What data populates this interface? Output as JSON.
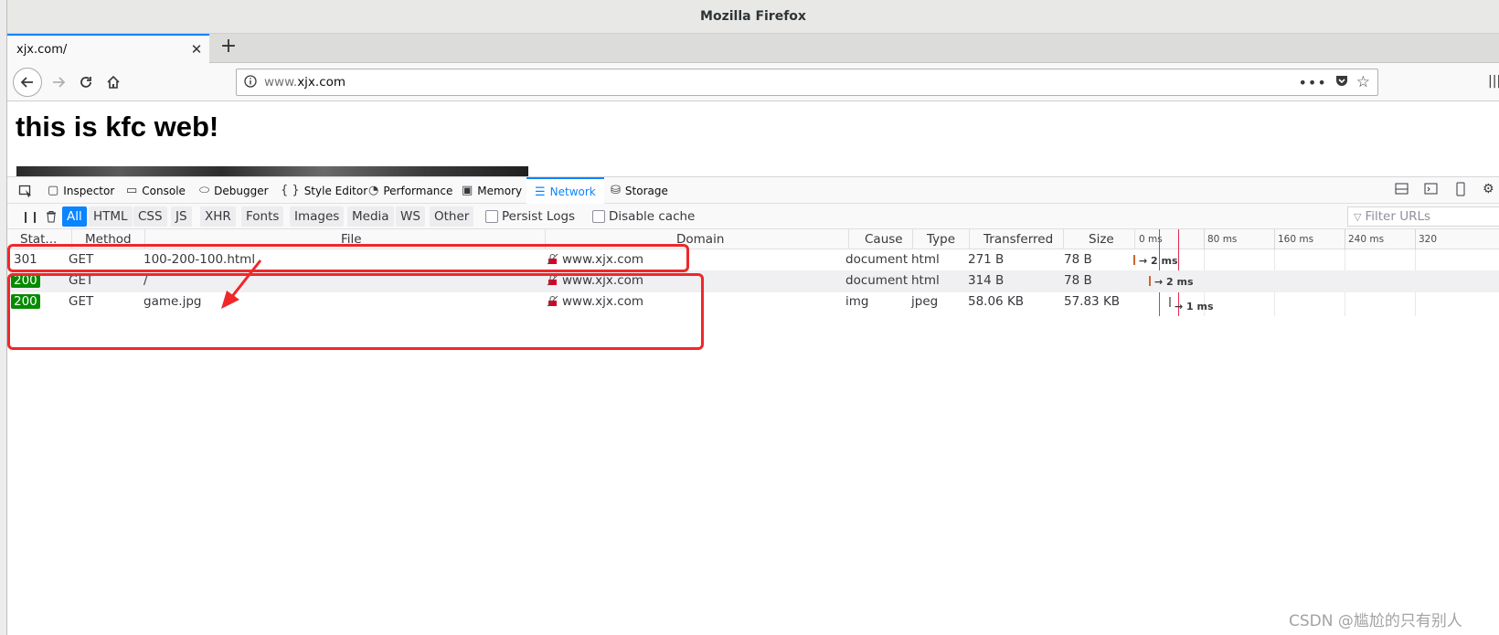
{
  "window": {
    "title": "Mozilla Firefox"
  },
  "tabs": [
    {
      "title": "xjx.com/",
      "close_icon": "close-icon"
    }
  ],
  "newtab_icon": "plus-icon",
  "navbar": {
    "url_prefix": "www.",
    "url_host": "xjx.com",
    "icons": [
      "back-arrow-icon",
      "forward-arrow-icon",
      "reload-icon",
      "home-icon",
      "info-icon",
      "more-icon",
      "pocket-icon",
      "star-icon",
      "library-icon"
    ]
  },
  "page": {
    "heading": "this is kfc web!"
  },
  "devtools": {
    "tabs": [
      {
        "label": "Inspector",
        "icon": "inspector-icon"
      },
      {
        "label": "Console",
        "icon": "console-icon"
      },
      {
        "label": "Debugger",
        "icon": "debugger-icon"
      },
      {
        "label": "Style Editor",
        "icon": "braces-icon"
      },
      {
        "label": "Performance",
        "icon": "performance-icon"
      },
      {
        "label": "Memory",
        "icon": "memory-icon"
      },
      {
        "label": "Network",
        "icon": "network-icon",
        "selected": true
      },
      {
        "label": "Storage",
        "icon": "storage-icon"
      }
    ],
    "filters": [
      "All",
      "HTML",
      "CSS",
      "JS",
      "XHR",
      "Fonts",
      "Images",
      "Media",
      "WS",
      "Other"
    ],
    "active_filter": "All",
    "persist_logs": "Persist Logs",
    "disable_cache": "Disable cache",
    "filter_urls_placeholder": "Filter URLs",
    "columns": {
      "status": "Stat...",
      "method": "Method",
      "file": "File",
      "domain": "Domain",
      "cause": "Cause",
      "type": "Type",
      "transferred": "Transferred",
      "size": "Size"
    },
    "waterfall_ticks": [
      "0 ms",
      "80 ms",
      "160 ms",
      "240 ms",
      "320"
    ],
    "requests": [
      {
        "status": "301",
        "method": "GET",
        "file": "100-200-100.html",
        "domain": "www.xjx.com",
        "cause": "document",
        "type": "html",
        "transferred": "271 B",
        "size": "78 B",
        "timing": "→ 2 ms"
      },
      {
        "status": "200",
        "method": "GET",
        "file": "/",
        "domain": "www.xjx.com",
        "cause": "document",
        "type": "html",
        "transferred": "314 B",
        "size": "78 B",
        "timing": "→ 2 ms"
      },
      {
        "status": "200",
        "method": "GET",
        "file": "game.jpg",
        "domain": "www.xjx.com",
        "cause": "img",
        "type": "jpeg",
        "transferred": "58.06 KB",
        "size": "57.83 KB",
        "timing": "→ 1 ms"
      }
    ]
  },
  "watermark": "CSDN @尴尬的只有别人",
  "colors": {
    "accent": "#0a84ff",
    "status_ok": "#058b00",
    "annotation": "#f0272a"
  }
}
